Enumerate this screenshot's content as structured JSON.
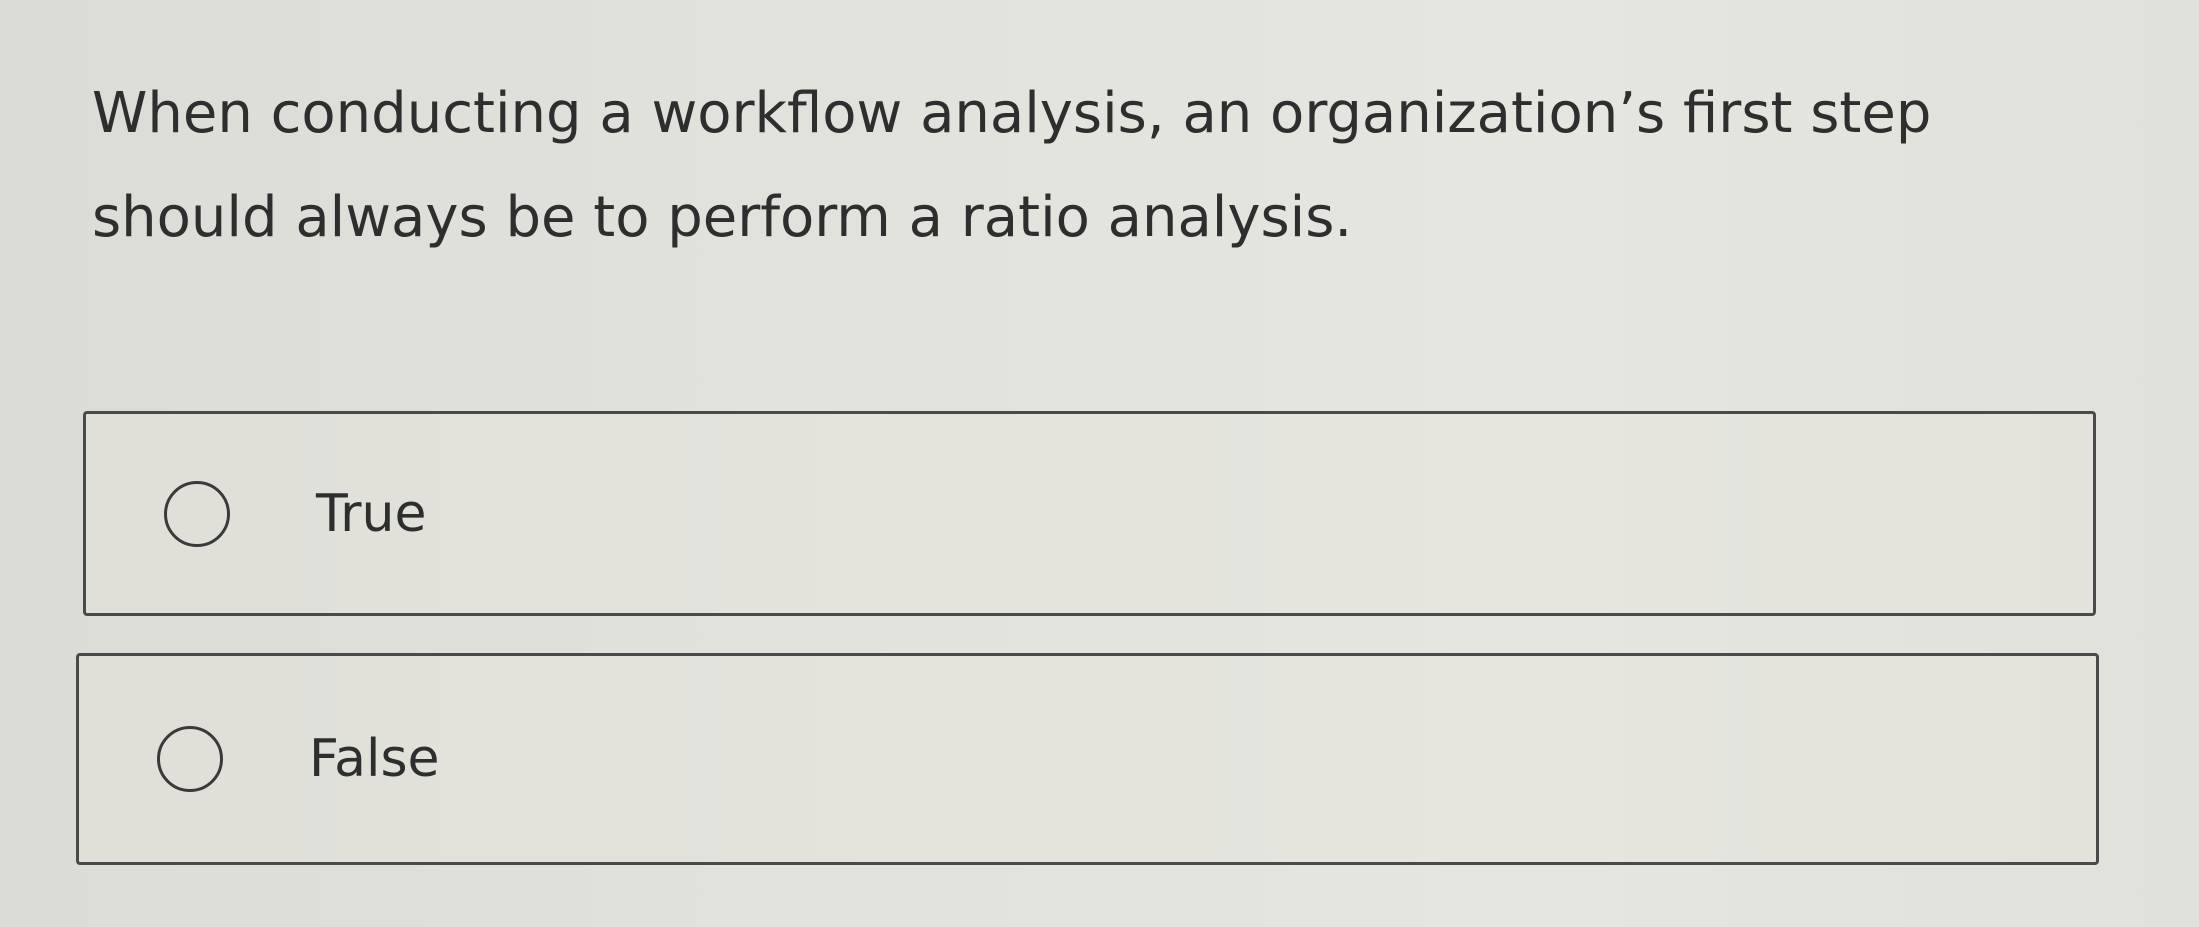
{
  "question": {
    "text": "When conducting a workflow analysis, an organization’s first step should always be to perform a ratio analysis."
  },
  "options": [
    {
      "label": "True",
      "selected": false
    },
    {
      "label": "False",
      "selected": false
    }
  ]
}
